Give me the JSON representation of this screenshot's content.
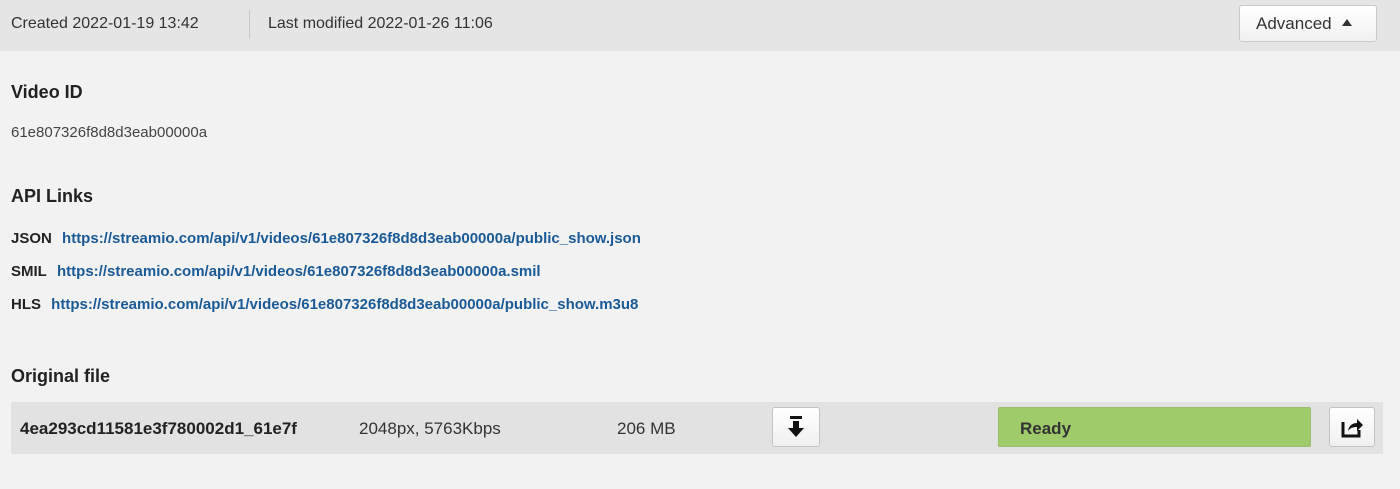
{
  "header": {
    "created": "Created 2022-01-19 13:42",
    "modified": "Last modified 2022-01-26 11:06",
    "advanced_label": "Advanced"
  },
  "video_id": {
    "heading": "Video ID",
    "value": "61e807326f8d8d3eab00000a"
  },
  "api_links": {
    "heading": "API Links",
    "items": [
      {
        "label": "JSON",
        "url": "https://streamio.com/api/v1/videos/61e807326f8d8d3eab00000a/public_show.json"
      },
      {
        "label": "SMIL",
        "url": "https://streamio.com/api/v1/videos/61e807326f8d8d3eab00000a.smil"
      },
      {
        "label": "HLS",
        "url": "https://streamio.com/api/v1/videos/61e807326f8d8d3eab00000a/public_show.m3u8"
      }
    ]
  },
  "original_file": {
    "heading": "Original file",
    "name": "4ea293cd11581e3f780002d1_61e7f",
    "specs": "2048px, 5763Kbps",
    "size": "206 MB",
    "status": "Ready",
    "progress": 1.0,
    "icons": {
      "download": "download-arrow-icon",
      "share": "share-arrow-icon"
    },
    "colors": {
      "status_fill": "#9fcb6b",
      "link": "#1a5a96"
    }
  }
}
